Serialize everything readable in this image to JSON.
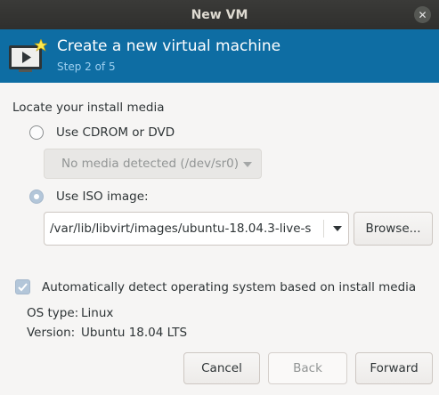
{
  "window": {
    "title": "New VM",
    "close_symbol": "✕"
  },
  "header": {
    "title": "Create a new virtual machine",
    "step": "Step 2 of 5"
  },
  "media": {
    "section_title": "Locate your install media",
    "cdrom": {
      "label": "Use CDROM or DVD",
      "selected": false,
      "dropdown_value": "No media detected (/dev/sr0)"
    },
    "iso": {
      "label": "Use ISO image:",
      "selected": true,
      "path": "/var/lib/libvirt/images/ubuntu-18.04.3-live-s",
      "browse_label": "Browse..."
    }
  },
  "os_detect": {
    "checkbox_label": "Automatically detect operating system based on install media",
    "checked": true,
    "os_type_label": "OS type:",
    "os_type_value": "Linux",
    "version_label": "Version:",
    "version_value": "Ubuntu 18.04 LTS"
  },
  "footer": {
    "cancel_label": "Cancel",
    "back_label": "Back",
    "forward_label": "Forward"
  },
  "colors": {
    "banner": "#0e6da3",
    "titlebar": "#2f2f2d",
    "selection": "#b3c6d9"
  }
}
